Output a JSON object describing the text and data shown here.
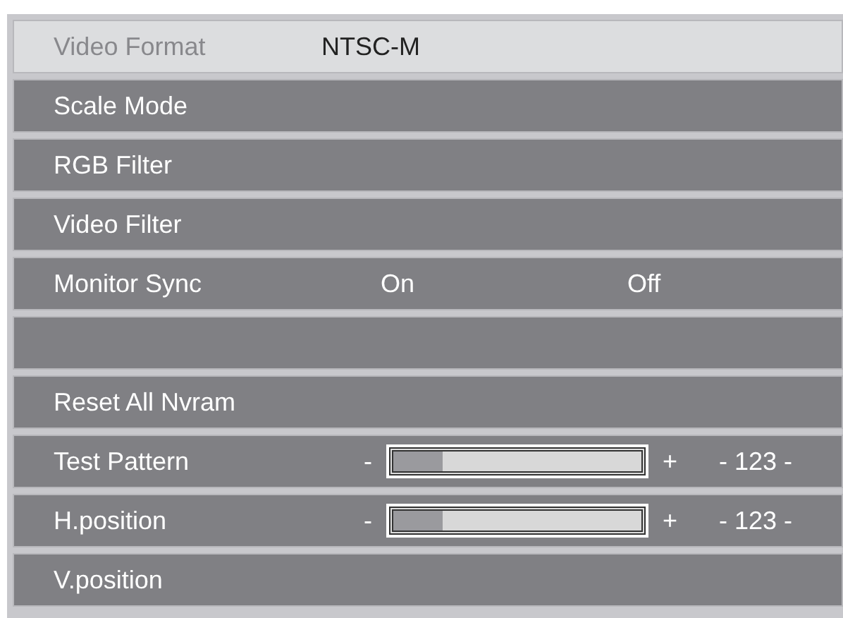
{
  "menu": {
    "rows": [
      {
        "kind": "value",
        "label": "Video Format",
        "value": "NTSC-M",
        "selected": true
      },
      {
        "kind": "plain",
        "label": "Scale Mode",
        "selected": false
      },
      {
        "kind": "plain",
        "label": "RGB Filter",
        "selected": false
      },
      {
        "kind": "plain",
        "label": "Video Filter",
        "selected": false
      },
      {
        "kind": "options",
        "label": "Monitor Sync",
        "options": [
          "On",
          "Off"
        ],
        "selected": false
      },
      {
        "kind": "blank",
        "selected": false
      },
      {
        "kind": "plain",
        "label": "Reset All Nvram",
        "selected": false
      },
      {
        "kind": "slider",
        "label": "Test Pattern",
        "minus": "-",
        "plus": "+",
        "level": 0.2,
        "reading": "- 123 -",
        "selected": false
      },
      {
        "kind": "slider",
        "label": "H.position",
        "minus": "-",
        "plus": "+",
        "level": 0.2,
        "reading": "- 123 -",
        "selected": false
      },
      {
        "kind": "plain",
        "label": "V.position",
        "selected": false
      }
    ]
  }
}
